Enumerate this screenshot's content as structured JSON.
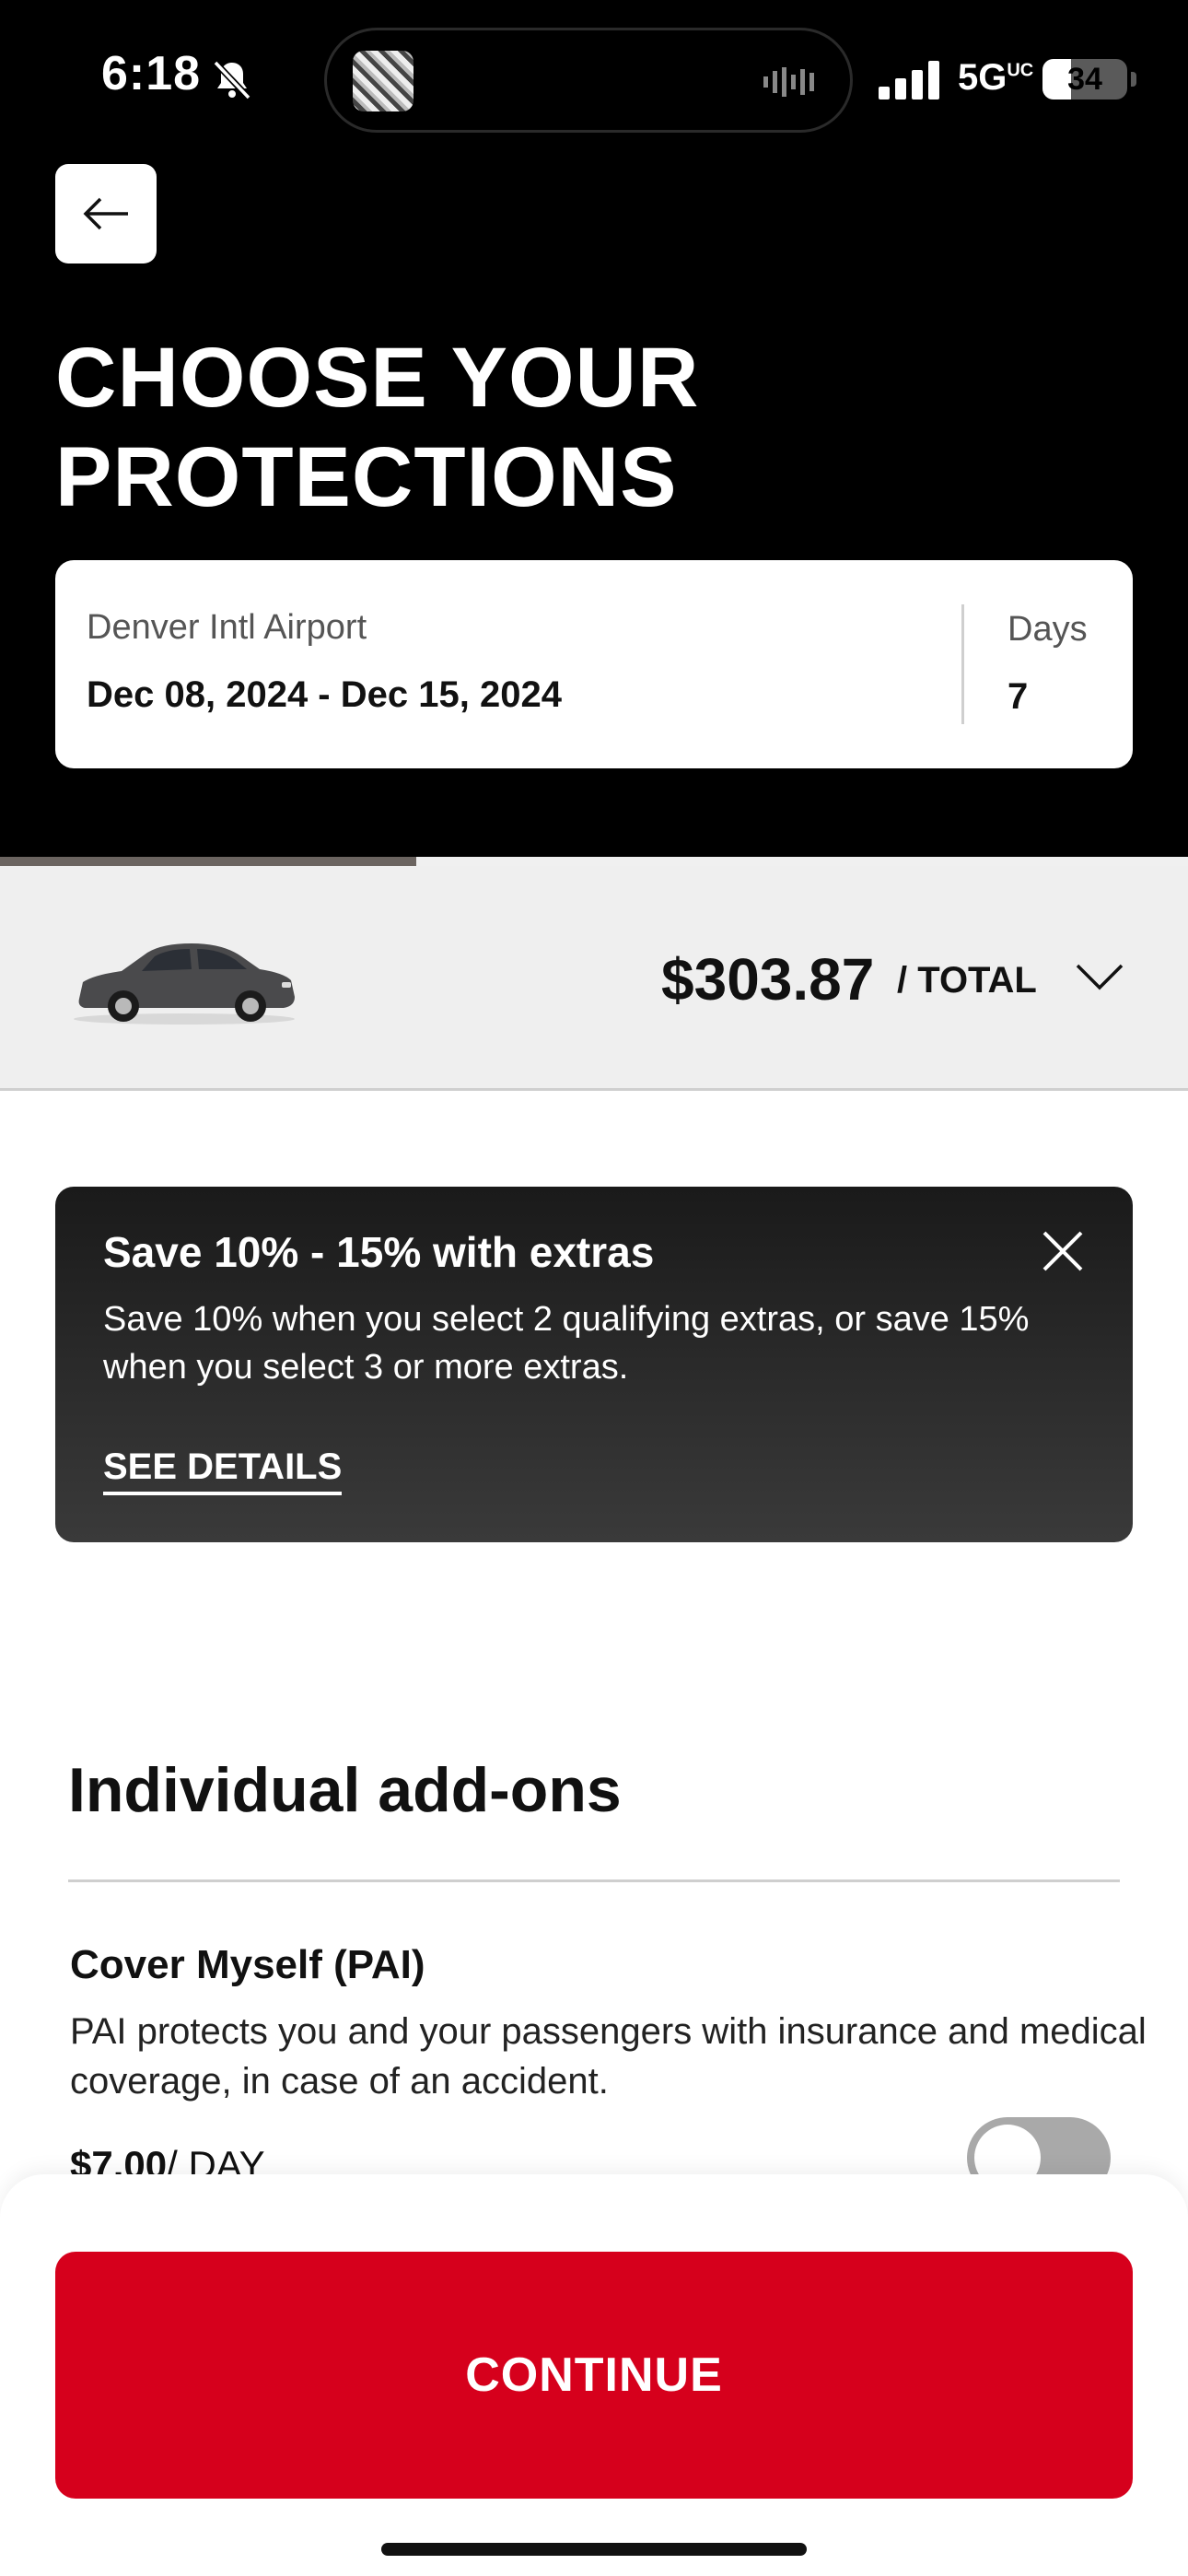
{
  "status_bar": {
    "time": "6:18",
    "network": "5G",
    "network_suffix": "UC",
    "battery_level": "34",
    "battery_fraction": 0.34
  },
  "header": {
    "title": "CHOOSE YOUR PROTECTIONS"
  },
  "trip": {
    "location": "Denver Intl Airport",
    "dates": "Dec 08, 2024 - Dec 15, 2024",
    "days_label": "Days",
    "days_value": "7"
  },
  "progress": {
    "fraction": 0.35
  },
  "summary": {
    "price": "$303.87",
    "price_suffix": "/ TOTAL"
  },
  "promo": {
    "title": "Save 10% - 15% with extras",
    "body": "Save 10% when you select 2 qualifying extras, or save 15% when you select 3 or more extras.",
    "link": "SEE DETAILS"
  },
  "addons": {
    "section_title": "Individual add-ons",
    "items": [
      {
        "title": "Cover Myself (PAI)",
        "description": "PAI protects you and your passengers with insurance and medical coverage, in case of an accident.",
        "price": "$7.00",
        "unit": "/ DAY",
        "enabled": false
      }
    ]
  },
  "footer": {
    "continue_label": "CONTINUE"
  },
  "colors": {
    "accent": "#d6001c",
    "header_bg": "#000000",
    "summary_bg": "#efefef"
  },
  "icons": [
    "bell-slash-icon",
    "waveform-icon",
    "signal-icon",
    "battery-icon",
    "arrow-left-icon",
    "car-image",
    "chevron-down-icon",
    "close-icon"
  ]
}
